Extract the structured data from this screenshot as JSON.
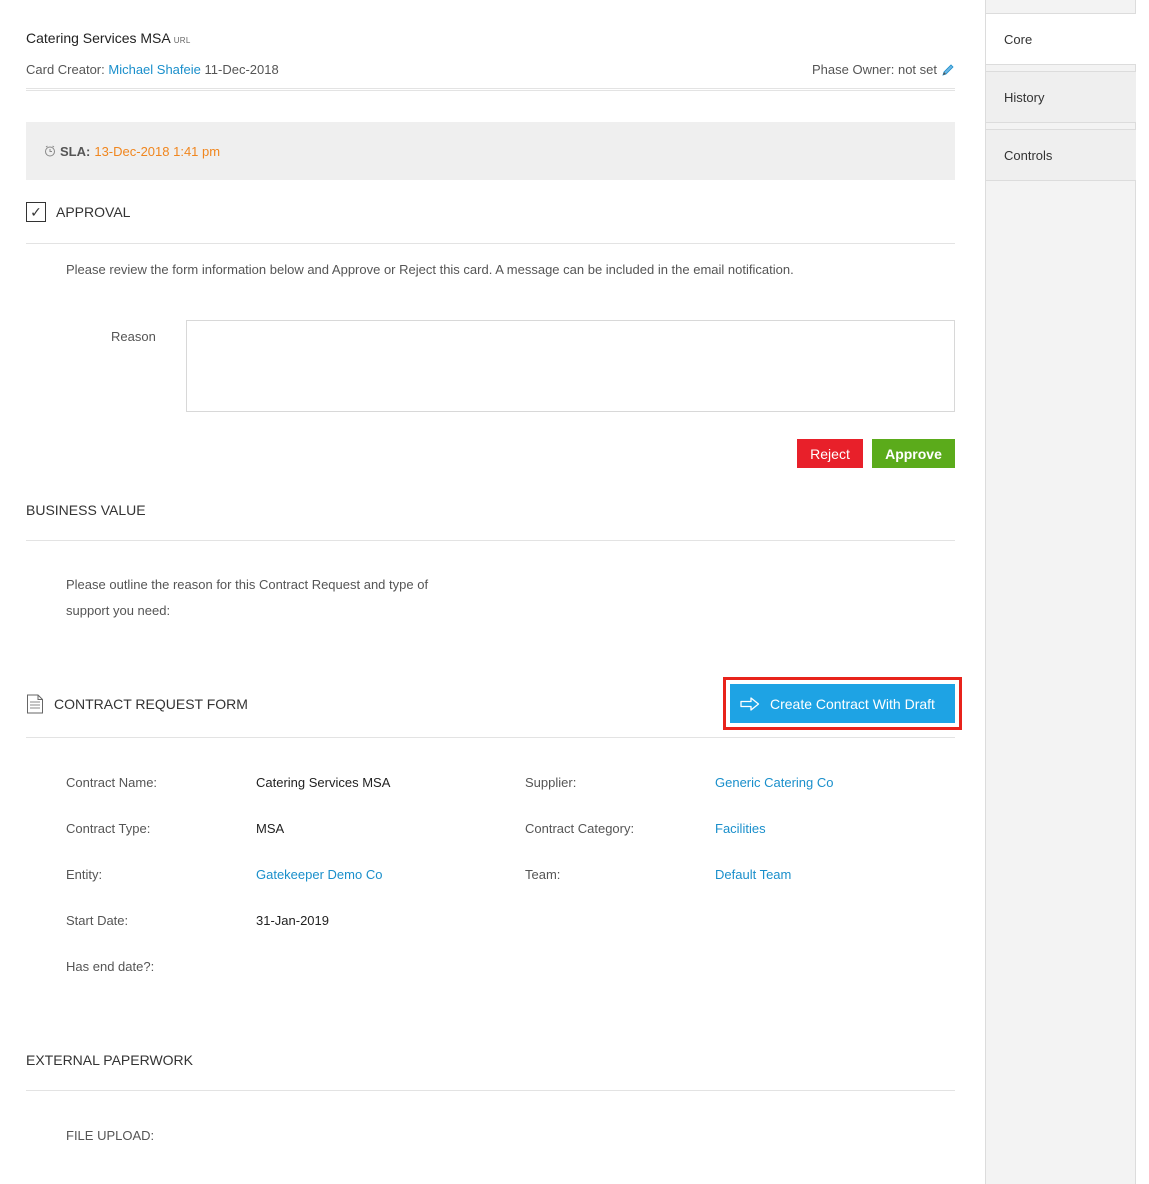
{
  "card": {
    "title": "Catering Services MSA",
    "url_tag": "URL",
    "creator_prefix": "Card Creator:",
    "creator_name": "Michael Shafeie",
    "created_date": "11-Dec-2018",
    "phase_owner": "Phase Owner: not set"
  },
  "sla": {
    "label": "SLA:",
    "value": "13-Dec-2018 1:41 pm"
  },
  "approval": {
    "heading": "APPROVAL",
    "description": "Please review the form information below and Approve or Reject this card. A message can be included in the email notification.",
    "reason_label": "Reason",
    "reason_value": "",
    "reject_label": "Reject",
    "approve_label": "Approve"
  },
  "business_value": {
    "heading": "BUSINESS VALUE",
    "description_line1": "Please outline the reason for this Contract Request and type of",
    "description_line2": "support you need:"
  },
  "contract_form": {
    "heading": "CONTRACT REQUEST FORM",
    "draft_button": "Create Contract With Draft",
    "fields": {
      "contract_name_label": "Contract Name:",
      "contract_name": "Catering Services MSA",
      "supplier_label": "Supplier:",
      "supplier": "Generic Catering Co",
      "contract_type_label": "Contract Type:",
      "contract_type": "MSA",
      "contract_category_label": "Contract Category:",
      "contract_category": "Facilities",
      "entity_label": "Entity:",
      "entity": "Gatekeeper Demo Co",
      "team_label": "Team:",
      "team": "Default Team",
      "start_date_label": "Start Date:",
      "start_date": "31-Jan-2019",
      "has_end_date_label": "Has end date?:"
    }
  },
  "external": {
    "heading": "EXTERNAL PAPERWORK",
    "file_upload_label": "FILE UPLOAD:"
  },
  "sidebar": {
    "tabs": [
      {
        "label": "Core"
      },
      {
        "label": "History"
      },
      {
        "label": "Controls"
      }
    ]
  },
  "colors": {
    "link": "#1a8fcb",
    "sla": "#f0861e",
    "reject": "#e8202a",
    "approve": "#5bab1b",
    "draft": "#1ea3e4",
    "highlight": "#e8231b"
  }
}
